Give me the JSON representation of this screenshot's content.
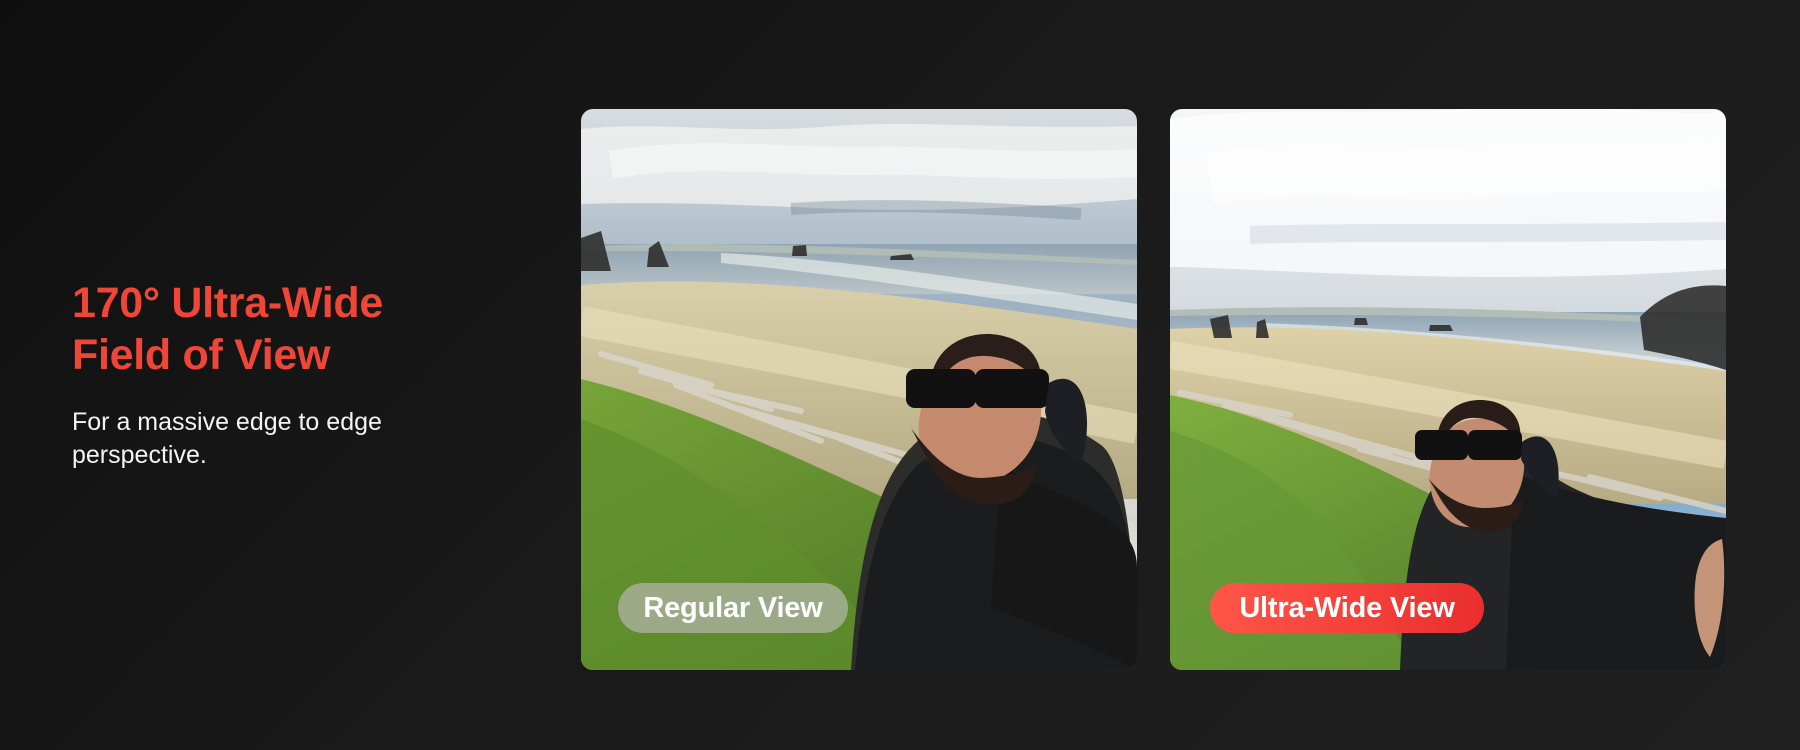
{
  "hero": {
    "headline_line1": "170° Ultra-Wide",
    "headline_line2": "Field of View",
    "subtitle": "For a massive edge to edge perspective."
  },
  "comparison": {
    "regular_label": "Regular View",
    "ultra_wide_label": "Ultra-Wide View"
  },
  "colors": {
    "accent": "#EF4637",
    "background": "#141414",
    "regular_pill": "#B4B4AA",
    "ultra_wide_pill": "#F24A3D"
  }
}
